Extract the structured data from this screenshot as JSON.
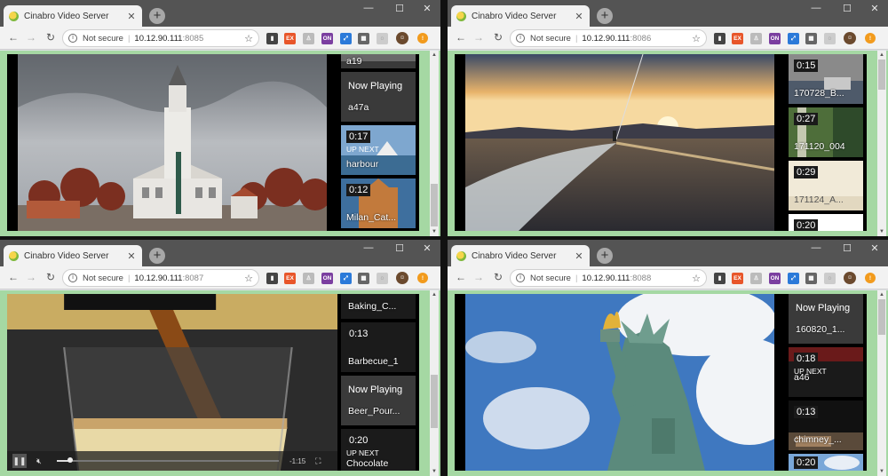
{
  "window_title": "Cinabro Video Server",
  "security_label": "Not secure",
  "host": "10.12.90.111",
  "extension_labels": {
    "ext_ex": "EX",
    "ext_on": "ON"
  },
  "colors": {
    "accent_green": "#a5d8a3",
    "titlebar": "#545454",
    "toolbar": "#f2f2f2",
    "orange_badge": "#f29b1d"
  },
  "icons": {
    "back": "arrow-left-icon",
    "forward": "arrow-right-icon",
    "reload": "reload-icon",
    "info": "info-icon",
    "bookmark": "star-icon",
    "menu": "menu-dots-icon"
  },
  "windows": [
    {
      "port": ":8085",
      "playlist": [
        {
          "name": "a19"
        },
        {
          "now_playing": "Now Playing",
          "name": "a47a"
        },
        {
          "duration": "0:17",
          "up_next": "UP NEXT",
          "name": "harbour"
        },
        {
          "duration": "0:12",
          "name": "Milan_Cat..."
        }
      ]
    },
    {
      "port": ":8086",
      "playlist": [
        {
          "duration": "0:15",
          "name": "170728_B..."
        },
        {
          "duration": "0:27",
          "name": "171120_004"
        },
        {
          "duration": "0:29",
          "name": "171124_A..."
        },
        {
          "duration": "0:20"
        }
      ]
    },
    {
      "port": ":8087",
      "playlist": [
        {
          "name": "Baking_C..."
        },
        {
          "duration": "0:13",
          "name": "Barbecue_1"
        },
        {
          "now_playing": "Now Playing",
          "name": "Beer_Pour..."
        },
        {
          "duration": "0:20",
          "up_next": "UP NEXT",
          "name": "Chocolate"
        }
      ],
      "controls": {
        "time_remaining": "-1:15",
        "progress_fraction": 0.06
      }
    },
    {
      "port": ":8088",
      "playlist": [
        {
          "now_playing": "Now Playing",
          "name": "160820_1..."
        },
        {
          "duration": "0:18",
          "up_next": "UP NEXT",
          "name": "a46"
        },
        {
          "duration": "0:13",
          "name": "chimney_..."
        },
        {
          "duration": "0:20"
        }
      ]
    }
  ]
}
